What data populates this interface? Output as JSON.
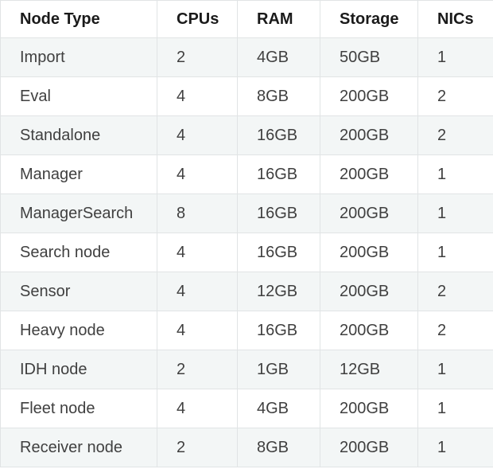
{
  "table": {
    "headers": [
      "Node Type",
      "CPUs",
      "RAM",
      "Storage",
      "NICs"
    ],
    "rows": [
      [
        "Import",
        "2",
        "4GB",
        "50GB",
        "1"
      ],
      [
        "Eval",
        "4",
        "8GB",
        "200GB",
        "2"
      ],
      [
        "Standalone",
        "4",
        "16GB",
        "200GB",
        "2"
      ],
      [
        "Manager",
        "4",
        "16GB",
        "200GB",
        "1"
      ],
      [
        "ManagerSearch",
        "8",
        "16GB",
        "200GB",
        "1"
      ],
      [
        "Search node",
        "4",
        "16GB",
        "200GB",
        "1"
      ],
      [
        "Sensor",
        "4",
        "12GB",
        "200GB",
        "2"
      ],
      [
        "Heavy node",
        "4",
        "16GB",
        "200GB",
        "2"
      ],
      [
        "IDH node",
        "2",
        "1GB",
        "12GB",
        "1"
      ],
      [
        "Fleet node",
        "4",
        "4GB",
        "200GB",
        "1"
      ],
      [
        "Receiver node",
        "2",
        "8GB",
        "200GB",
        "1"
      ]
    ]
  },
  "colors": {
    "row_stripe": "#f3f6f6",
    "border": "#e1e4e5",
    "header_text": "#1a1a1a",
    "body_text": "#404040"
  }
}
